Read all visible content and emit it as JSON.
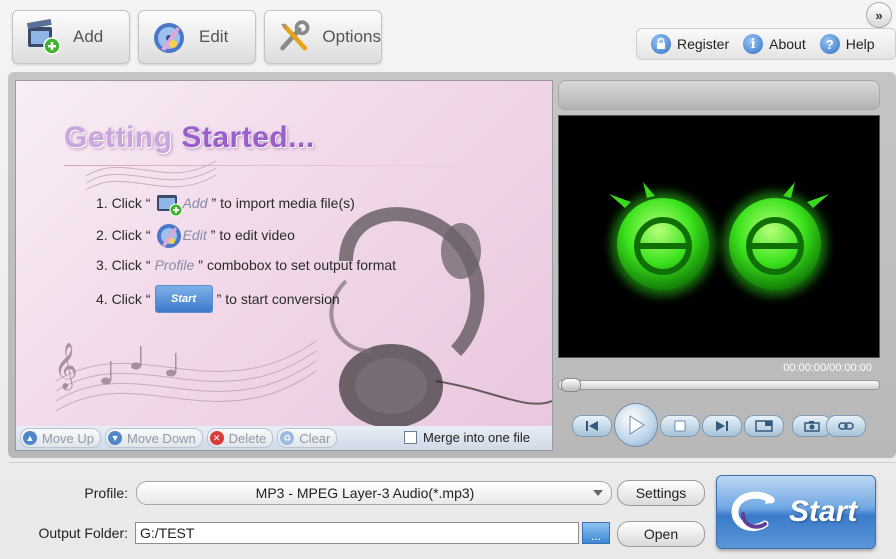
{
  "toolbar": {
    "add_label": "Add",
    "edit_label": "Edit",
    "options_label": "Options"
  },
  "expand_glyph": "»",
  "helpbar": {
    "register": "Register",
    "about": "About",
    "help": "Help"
  },
  "getting_started": {
    "title_part1": "Getting",
    "title_part2": "Started...",
    "steps": [
      {
        "prefix": "1. Click",
        "icon": "add-icon",
        "button_text": "Add",
        "suffix": "to import media file(s)"
      },
      {
        "prefix": "2. Click",
        "icon": "edit-icon",
        "button_text": "Edit",
        "suffix": "to edit video"
      },
      {
        "prefix": "3. Click",
        "icon": "",
        "button_text": "Profile",
        "suffix": "combobox to set output format"
      },
      {
        "prefix": "4. Click",
        "icon": "start-icon",
        "button_text": "Start",
        "suffix": "to start conversion"
      }
    ]
  },
  "list_actions": {
    "move_up": "Move Up",
    "move_down": "Move Down",
    "delete": "Delete",
    "clear": "Clear",
    "merge_label": "Merge into one file",
    "merge_checked": false
  },
  "player": {
    "timecode": "00:00:00/00:00:00",
    "progress": 0
  },
  "profile": {
    "label": "Profile:",
    "value": "MP3 - MPEG Layer-3 Audio(*.mp3)",
    "settings_label": "Settings"
  },
  "output": {
    "label": "Output Folder:",
    "value": "G:/TEST",
    "browse_label": "...",
    "open_label": "Open"
  },
  "start_label": "Start",
  "colors": {
    "accent_blue": "#3a7ac9",
    "title_purple": "#9b5fc9",
    "logo_green": "#35e01b"
  }
}
